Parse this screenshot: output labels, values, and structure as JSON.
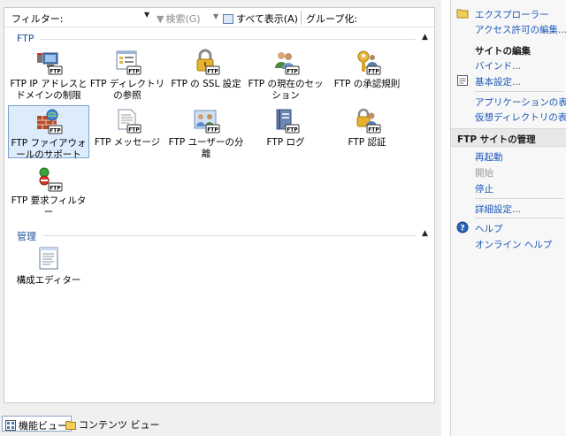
{
  "toolbar": {
    "filter_label": "フィルター:",
    "filter_value": "",
    "search_label": "検索(G)",
    "show_all_label": "すべて表示(A)",
    "group_label": "グループ化:"
  },
  "sections": [
    {
      "title": "FTP",
      "features": [
        {
          "label": "FTP IP アドレスとドメインの制限",
          "icon": "ip-restriction-icon"
        },
        {
          "label": "FTP ディレクトリの参照",
          "icon": "directory-browse-icon"
        },
        {
          "label": "FTP の SSL 設定",
          "icon": "ssl-lock-icon"
        },
        {
          "label": "FTP の現在のセッション",
          "icon": "sessions-icon"
        },
        {
          "label": "FTP の承認規則",
          "icon": "authorization-key-icon"
        },
        {
          "label": "FTP ファイアウォールのサポート",
          "icon": "firewall-icon",
          "selected": true
        },
        {
          "label": "FTP メッセージ",
          "icon": "message-icon"
        },
        {
          "label": "FTP ユーザーの分離",
          "icon": "user-isolation-icon"
        },
        {
          "label": "FTP ログ",
          "icon": "log-book-icon"
        },
        {
          "label": "FTP 認証",
          "icon": "authentication-icon"
        },
        {
          "label": "FTP 要求フィルター",
          "icon": "request-filter-icon"
        }
      ]
    },
    {
      "title": "管理",
      "features": [
        {
          "label": "構成エディター",
          "icon": "config-editor-icon"
        }
      ]
    }
  ],
  "view_tabs": [
    {
      "label": "機能ビュー",
      "active": true
    },
    {
      "label": "コンテンツ ビュー",
      "active": false
    }
  ],
  "actions": {
    "explore": "エクスプローラー",
    "edit_permissions": "アクセス許可の編集...",
    "edit_site_head": "サイトの編集",
    "bindings": "バインド...",
    "basic_settings": "基本設定...",
    "view_applications": "アプリケーションの表示",
    "view_virtual_dirs": "仮想ディレクトリの表示",
    "manage_head": "FTP サイトの管理",
    "restart": "再起動",
    "start": "開始",
    "stop": "停止",
    "advanced_settings": "詳細設定...",
    "help": "ヘルプ",
    "online_help": "オンライン ヘルプ"
  },
  "colors": {
    "link": "#1a56b8",
    "section_header": "#1e4e99",
    "selection": "#dcecfc"
  }
}
